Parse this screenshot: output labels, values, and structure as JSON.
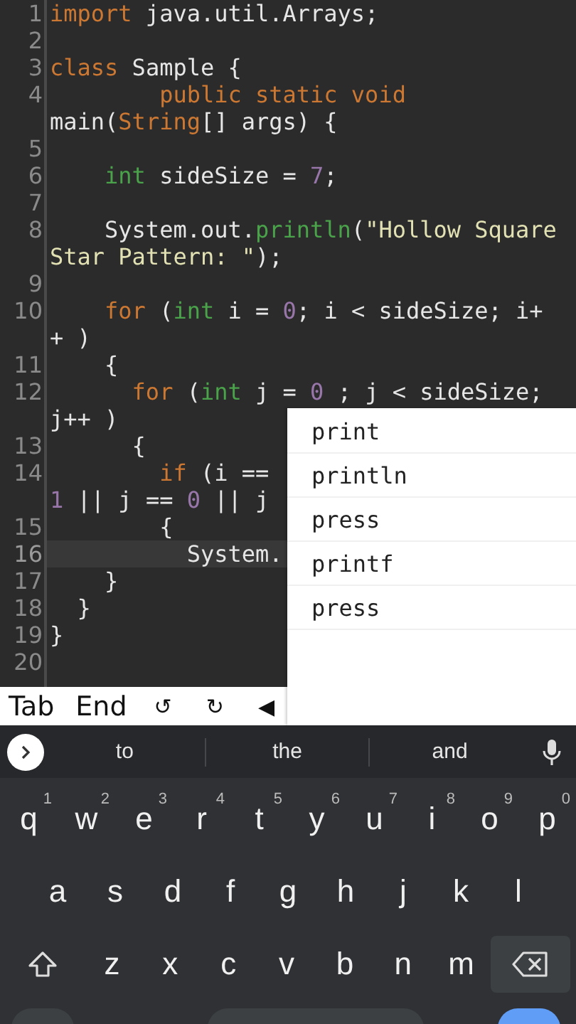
{
  "editor": {
    "lines": [
      {
        "number": "1",
        "current": false,
        "segments": [
          {
            "tokens": [
              {
                "kind": "kw",
                "text": "import"
              },
              {
                "kind": "plain",
                "text": " java.util.Arrays;"
              }
            ]
          }
        ]
      },
      {
        "number": "2",
        "current": false
      },
      {
        "number": "3",
        "current": false,
        "segments": [
          {
            "tokens": [
              {
                "kind": "kw",
                "text": "class"
              },
              {
                "kind": "plain",
                "text": " Sample {"
              }
            ]
          }
        ]
      },
      {
        "number": "4",
        "current": false,
        "segments": [
          {
            "tokens": [
              {
                "kind": "kw",
                "text": "        public static void"
              }
            ]
          },
          {
            "tokens": [
              {
                "kind": "plain",
                "text": "main("
              },
              {
                "kind": "kw",
                "text": "String"
              },
              {
                "kind": "plain",
                "text": "[] args) {"
              }
            ]
          }
        ]
      },
      {
        "number": "5",
        "current": false
      },
      {
        "number": "6",
        "current": false,
        "segments": [
          {
            "tokens": [
              {
                "kind": "type",
                "text": "    int"
              },
              {
                "kind": "plain",
                "text": " sideSize = "
              },
              {
                "kind": "num",
                "text": "7"
              },
              {
                "kind": "plain",
                "text": ";"
              }
            ]
          }
        ]
      },
      {
        "number": "7",
        "current": false
      },
      {
        "number": "8",
        "current": false,
        "segments": [
          {
            "tokens": [
              {
                "kind": "plain",
                "text": "    System.out."
              },
              {
                "kind": "type",
                "text": "println"
              },
              {
                "kind": "plain",
                "text": "("
              },
              {
                "kind": "str",
                "text": "\"Hollow Square"
              }
            ]
          },
          {
            "tokens": [
              {
                "kind": "str",
                "text": "Star Pattern: \""
              },
              {
                "kind": "plain",
                "text": ");"
              }
            ]
          }
        ]
      },
      {
        "number": "9",
        "current": false
      },
      {
        "number": "10",
        "current": false,
        "segments": [
          {
            "tokens": [
              {
                "kind": "kw",
                "text": "    for"
              },
              {
                "kind": "plain",
                "text": " ("
              },
              {
                "kind": "type",
                "text": "int"
              },
              {
                "kind": "plain",
                "text": " i = "
              },
              {
                "kind": "num",
                "text": "0"
              },
              {
                "kind": "plain",
                "text": "; i < sideSize; i+"
              }
            ]
          },
          {
            "tokens": [
              {
                "kind": "plain",
                "text": "+ )"
              }
            ]
          }
        ]
      },
      {
        "number": "11",
        "current": false,
        "segments": [
          {
            "tokens": [
              {
                "kind": "plain",
                "text": "    {"
              }
            ]
          }
        ]
      },
      {
        "number": "12",
        "current": false,
        "segments": [
          {
            "tokens": [
              {
                "kind": "kw",
                "text": "      for"
              },
              {
                "kind": "plain",
                "text": " ("
              },
              {
                "kind": "type",
                "text": "int"
              },
              {
                "kind": "plain",
                "text": " j = "
              },
              {
                "kind": "num",
                "text": "0"
              },
              {
                "kind": "plain",
                "text": " ; j < sideSize;"
              }
            ]
          },
          {
            "tokens": [
              {
                "kind": "plain",
                "text": "j++ )"
              }
            ]
          }
        ]
      },
      {
        "number": "13",
        "current": false,
        "segments": [
          {
            "tokens": [
              {
                "kind": "plain",
                "text": "      {"
              }
            ]
          }
        ]
      },
      {
        "number": "14",
        "current": false,
        "segments": [
          {
            "tokens": [
              {
                "kind": "kw",
                "text": "        if"
              },
              {
                "kind": "plain",
                "text": " (i =="
              }
            ]
          },
          {
            "tokens": [
              {
                "kind": "num",
                "text": "1"
              },
              {
                "kind": "plain",
                "text": " || j == "
              },
              {
                "kind": "num",
                "text": "0"
              },
              {
                "kind": "plain",
                "text": " || j"
              }
            ]
          }
        ]
      },
      {
        "number": "15",
        "current": false,
        "segments": [
          {
            "tokens": [
              {
                "kind": "plain",
                "text": "        {"
              }
            ]
          }
        ]
      },
      {
        "number": "16",
        "current": true,
        "segments": [
          {
            "tokens": [
              {
                "kind": "plain",
                "text": "          System."
              }
            ]
          }
        ]
      },
      {
        "number": "17",
        "current": false,
        "segments": [
          {
            "tokens": [
              {
                "kind": "plain",
                "text": "    }"
              }
            ]
          }
        ]
      },
      {
        "number": "18",
        "current": false,
        "segments": [
          {
            "tokens": [
              {
                "kind": "plain",
                "text": "  }"
              }
            ]
          }
        ]
      },
      {
        "number": "19",
        "current": false,
        "segments": [
          {
            "tokens": [
              {
                "kind": "plain",
                "text": "}"
              }
            ]
          }
        ]
      },
      {
        "number": "20",
        "current": false
      }
    ]
  },
  "suggestions": [
    "print",
    "println",
    "press",
    "printf",
    "press"
  ],
  "extra_keys": [
    {
      "kind": "text",
      "label": "Tab"
    },
    {
      "kind": "text",
      "label": "End"
    },
    {
      "kind": "symbol",
      "label": "↺"
    },
    {
      "kind": "symbol",
      "label": "↻"
    },
    {
      "kind": "symbol",
      "label": "◀"
    }
  ],
  "keyboard": {
    "suggestions": [
      "to",
      "the",
      "and"
    ],
    "rows": [
      [
        {
          "label": "q",
          "hint": "1"
        },
        {
          "label": "w",
          "hint": "2"
        },
        {
          "label": "e",
          "hint": "3"
        },
        {
          "label": "r",
          "hint": "4"
        },
        {
          "label": "t",
          "hint": "5"
        },
        {
          "label": "y",
          "hint": "6"
        },
        {
          "label": "u",
          "hint": "7"
        },
        {
          "label": "i",
          "hint": "8"
        },
        {
          "label": "o",
          "hint": "9"
        },
        {
          "label": "p",
          "hint": "0"
        }
      ],
      [
        {
          "label": "a"
        },
        {
          "label": "s"
        },
        {
          "label": "d"
        },
        {
          "label": "f"
        },
        {
          "label": "g"
        },
        {
          "label": "h"
        },
        {
          "label": "j"
        },
        {
          "label": "k"
        },
        {
          "label": "l"
        }
      ],
      [
        {
          "label": "z"
        },
        {
          "label": "x"
        },
        {
          "label": "c"
        },
        {
          "label": "v"
        },
        {
          "label": "b"
        },
        {
          "label": "n"
        },
        {
          "label": "m"
        }
      ]
    ]
  }
}
